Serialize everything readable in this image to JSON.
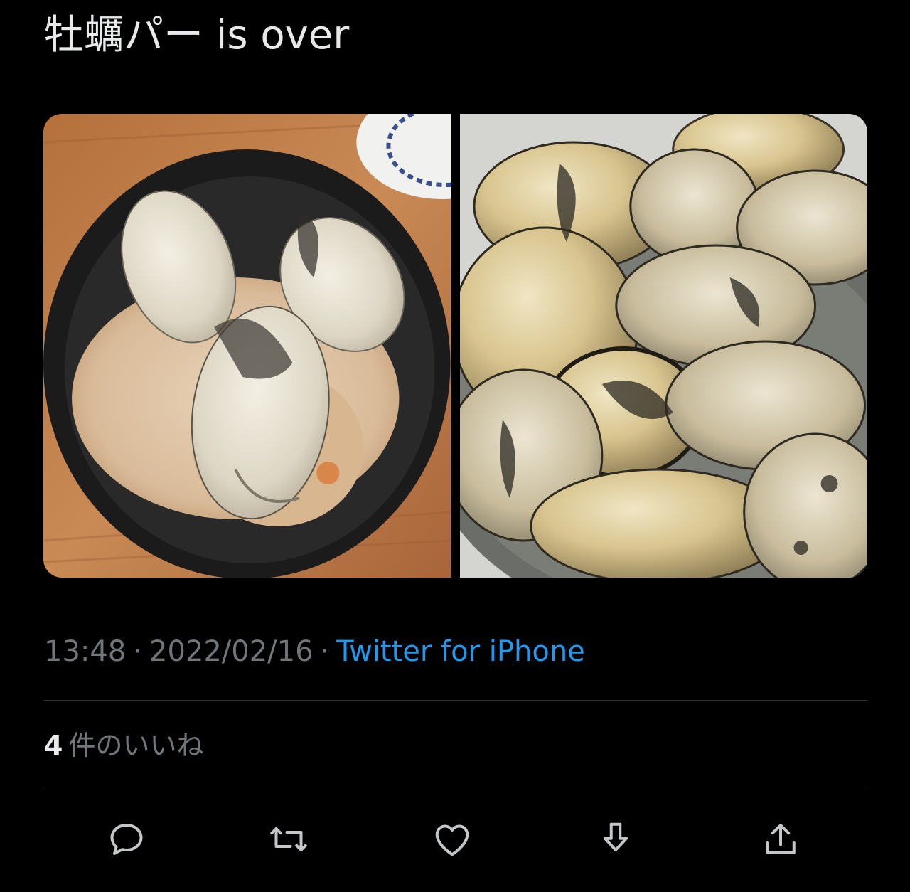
{
  "tweet": {
    "text": "牡蠣パー is over",
    "media": [
      {
        "icon": "oyster-rice-bowl-photo"
      },
      {
        "icon": "grilled-oysters-plate-photo"
      }
    ],
    "meta": {
      "time": "13:48",
      "separator": "·",
      "date": "2022/02/16",
      "source": "Twitter for iPhone"
    },
    "likes": {
      "count": "4",
      "label": "件のいいね"
    },
    "actions": [
      {
        "icon": "reply-icon"
      },
      {
        "icon": "retweet-icon"
      },
      {
        "icon": "like-icon"
      },
      {
        "icon": "bookmark-download-icon"
      },
      {
        "icon": "share-icon"
      }
    ]
  },
  "colors": {
    "background": "#000000",
    "text": "#e7e9ea",
    "muted": "#71767b",
    "link": "#1d9bf0",
    "divider": "#2f3336"
  }
}
